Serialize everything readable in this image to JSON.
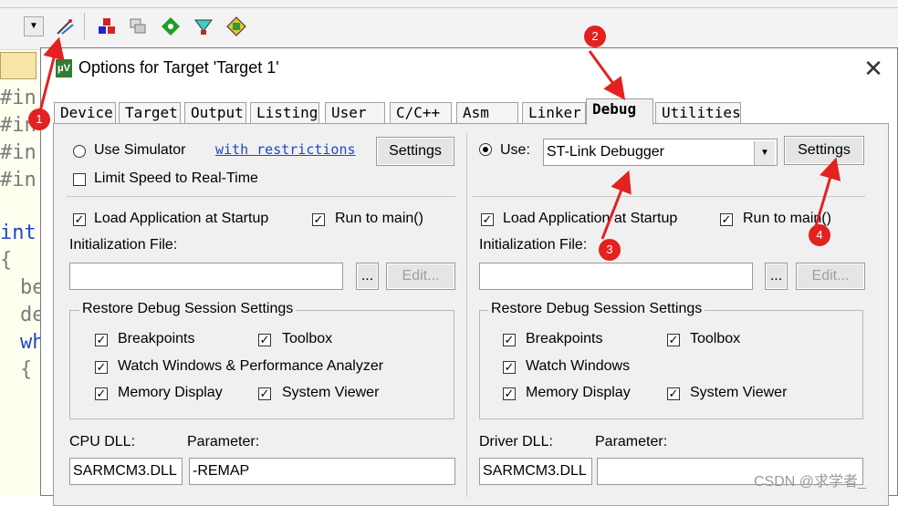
{
  "dialog": {
    "title": "Options for Target 'Target 1'",
    "close_glyph": "✕",
    "tabs": [
      "Device",
      "Target",
      "Output",
      "Listing",
      "User",
      "C/C++",
      "Asm",
      "Linker",
      "Debug",
      "Utilities"
    ],
    "active_tab": "Debug"
  },
  "left": {
    "use_simulator_label": "Use Simulator",
    "use_simulator_checked": false,
    "restrictions_link": "with restrictions",
    "settings_label": "Settings",
    "limit_speed_label": "Limit Speed to Real-Time",
    "limit_speed_checked": false,
    "load_app_label": "Load Application at Startup",
    "load_app_checked": true,
    "run_to_main_label": "Run to main()",
    "run_to_main_checked": true,
    "init_file_label": "Initialization File:",
    "init_file_value": "",
    "browse_label": "...",
    "edit_label": "Edit...",
    "restore_group_title": "Restore Debug Session Settings",
    "breakpoints_label": "Breakpoints",
    "toolbox_label": "Toolbox",
    "watch_label": "Watch Windows & Performance Analyzer",
    "memory_label": "Memory Display",
    "system_viewer_label": "System Viewer",
    "dll_label": "CPU DLL:",
    "parameter_label": "Parameter:",
    "dll_value": "SARMCM3.DLL",
    "parameter_value": "-REMAP"
  },
  "right": {
    "use_label": "Use:",
    "use_checked": true,
    "debugger_value": "ST-Link Debugger",
    "settings_label": "Settings",
    "load_app_label": "Load Application at Startup",
    "load_app_checked": true,
    "run_to_main_label": "Run to main()",
    "run_to_main_checked": true,
    "init_file_label": "Initialization File:",
    "init_file_value": "",
    "browse_label": "...",
    "edit_label": "Edit...",
    "restore_group_title": "Restore Debug Session Settings",
    "breakpoints_label": "Breakpoints",
    "toolbox_label": "Toolbox",
    "watch_label": "Watch Windows",
    "memory_label": "Memory Display",
    "system_viewer_label": "System Viewer",
    "dll_label": "Driver DLL:",
    "parameter_label": "Parameter:",
    "dll_value": "SARMCM3.DLL",
    "parameter_value": ""
  },
  "code_fragments": [
    "#in",
    "#in",
    "#in",
    "#in",
    "int",
    "{",
    "be",
    "de",
    "wh",
    "{"
  ],
  "markers": [
    "1",
    "2",
    "3",
    "4"
  ],
  "watermark": "CSDN @求学者_",
  "colors": {
    "marker": "#e32121",
    "link": "#1f47c8",
    "tab_body": "#f0f0f0"
  },
  "icons": [
    "dropdown-icon",
    "options-wand-icon",
    "load-icon",
    "copy-icon",
    "green-diamond-icon",
    "download-icon",
    "flash-icon"
  ]
}
